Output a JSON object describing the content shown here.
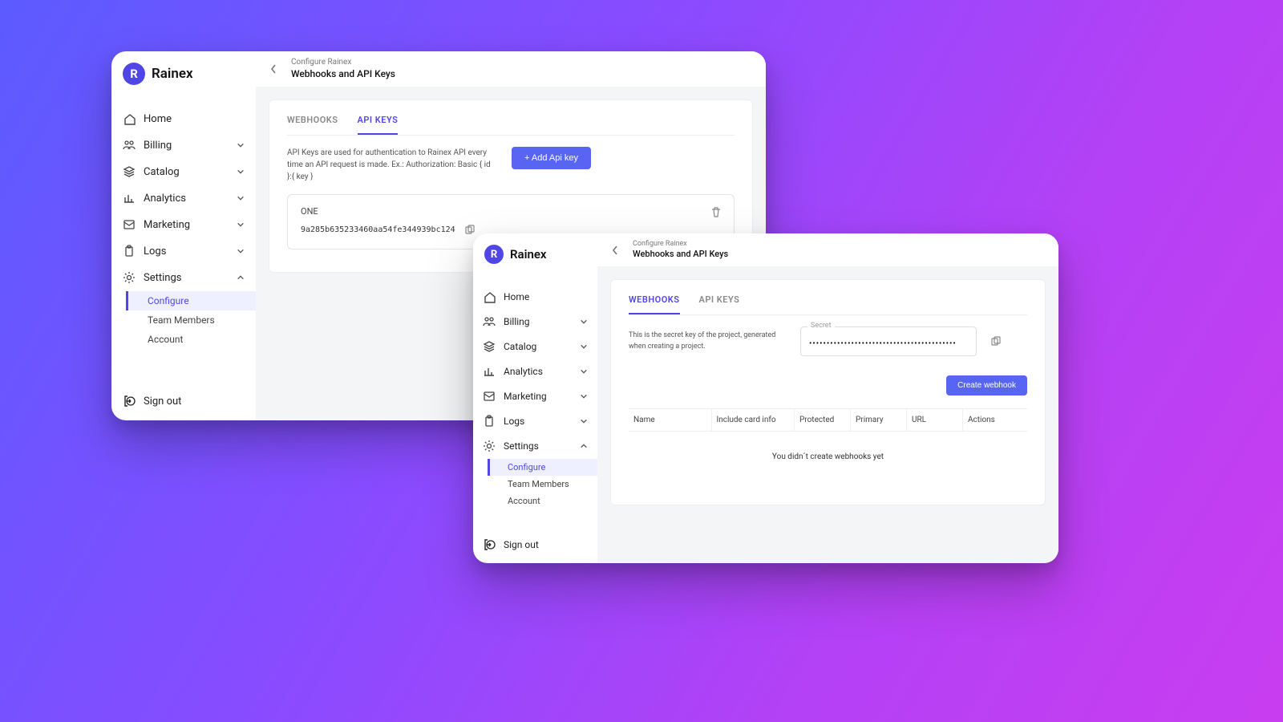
{
  "brand": {
    "mark": "R",
    "name": "Rainex"
  },
  "nav": {
    "items": [
      {
        "label": "Home"
      },
      {
        "label": "Billing"
      },
      {
        "label": "Catalog"
      },
      {
        "label": "Analytics"
      },
      {
        "label": "Marketing"
      },
      {
        "label": "Logs"
      },
      {
        "label": "Settings"
      }
    ],
    "settings_children": [
      {
        "label": "Configure"
      },
      {
        "label": "Team Members"
      },
      {
        "label": "Account"
      }
    ],
    "signout": "Sign out"
  },
  "crumb": {
    "top": "Configure Rainex",
    "bottom": "Webhooks and API Keys"
  },
  "tabs": {
    "webhooks": "WEBHOOKS",
    "apikeys": "API KEYS"
  },
  "window_a": {
    "active_tab": "apikeys",
    "help": "API Keys are used for authentication to Rainex API every time an API request is made. Ex.: Authorization: Basic { id }:{ key }",
    "add_btn": "+ Add Api key",
    "key": {
      "name": "ONE",
      "value": "9a285b635233460aa54fe344939bc124"
    }
  },
  "window_b": {
    "active_tab": "webhooks",
    "help": "This is the secret key of the project, generated when creating a project.",
    "secret_label": "Secret",
    "secret_value": "••••••••••••••••••••••••••••••••••••••••••",
    "create_btn": "Create webhook",
    "columns": {
      "name": "Name",
      "card": "Include card info",
      "protected": "Protected",
      "primary": "Primary",
      "url": "URL",
      "actions": "Actions"
    },
    "empty": "You didn´t create webhooks yet"
  }
}
